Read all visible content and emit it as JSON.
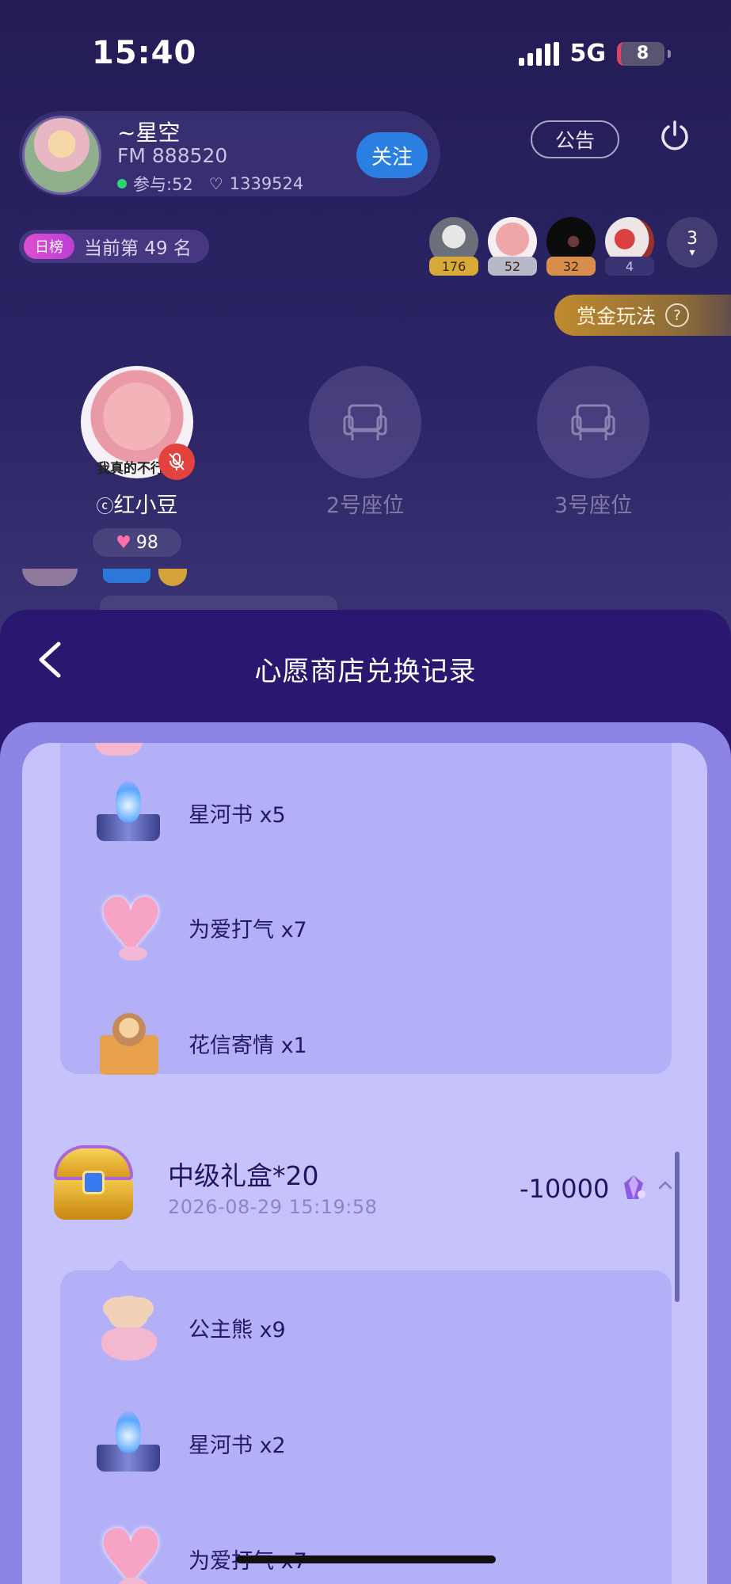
{
  "status_bar": {
    "time": "15:40",
    "network": "5G",
    "battery": "8"
  },
  "room": {
    "name": "~星空",
    "fm": "FM 888520",
    "participants_label": "参与:52",
    "likes": "1339524",
    "follow_label": "关注",
    "notice_label": "公告"
  },
  "rank": {
    "badge": "日榜",
    "text": "当前第 49 名"
  },
  "viewers": [
    {
      "count": "176",
      "color": "#d7a93a"
    },
    {
      "count": "52",
      "color": "#b8b8c8"
    },
    {
      "count": "32",
      "color": "#d88e4a"
    },
    {
      "count": "4",
      "color": "#3a3475"
    }
  ],
  "viewer_more": "3",
  "bounty_label": "赏金玩法",
  "seats": [
    {
      "label": "红小豆",
      "charm": "98",
      "overlay": "我真的不行"
    },
    {
      "label": "2号座位"
    },
    {
      "label": "3号座位"
    }
  ],
  "sheet": {
    "title": "心愿商店兑换记录",
    "group1": [
      {
        "name": "星河书 x5",
        "icon": "book-icon"
      },
      {
        "name": "为爱打气 x7",
        "icon": "heart-icon"
      },
      {
        "name": "花信寄情 x1",
        "icon": "envelope-icon"
      }
    ],
    "order": {
      "title": "中级礼盒*20",
      "time": "2026-08-29 15:19:58",
      "amount": "-10000"
    },
    "group2": [
      {
        "name": "公主熊 x9",
        "icon": "bear-icon"
      },
      {
        "name": "星河书 x2",
        "icon": "book-icon"
      },
      {
        "name": "为爱打气 x7",
        "icon": "heart-icon"
      }
    ]
  }
}
